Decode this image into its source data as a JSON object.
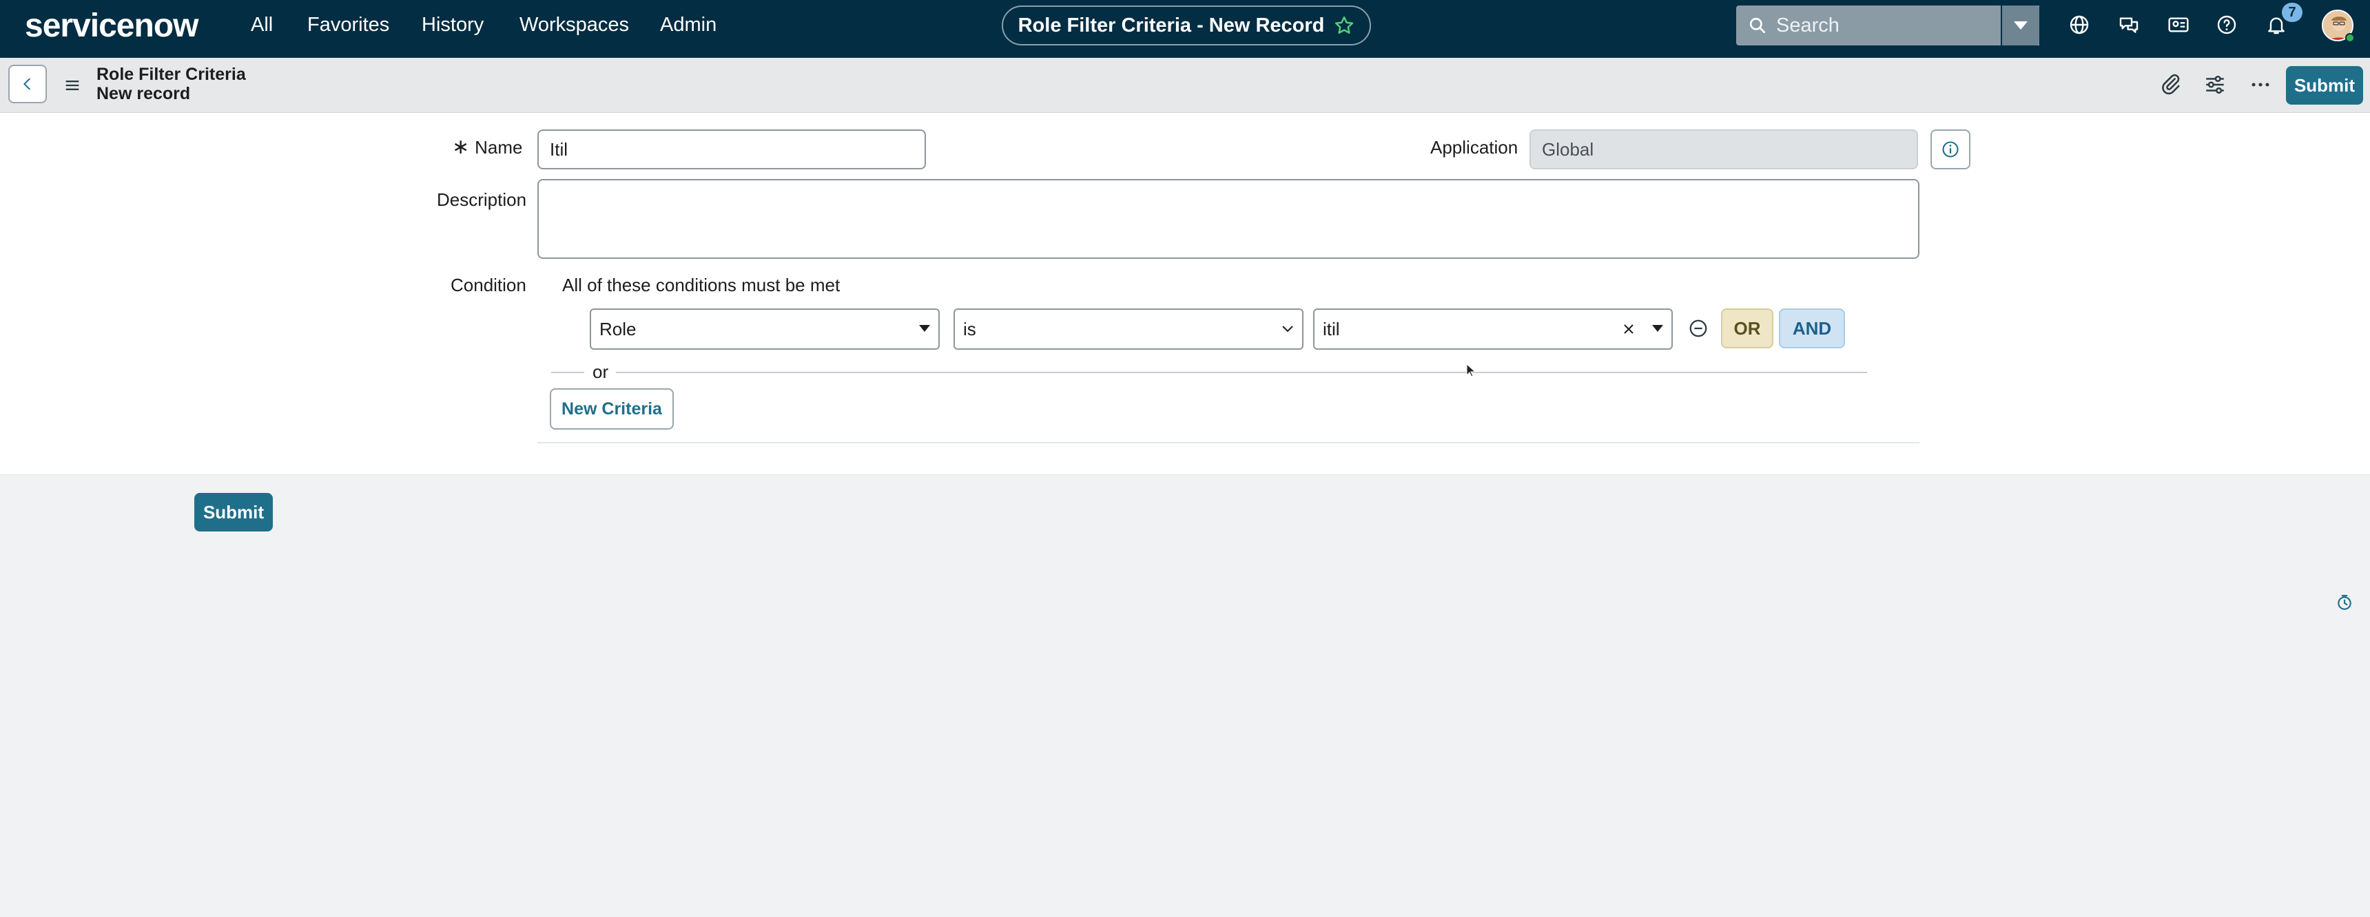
{
  "topnav": {
    "logo": "servicenow",
    "items": [
      "All",
      "Favorites",
      "History",
      "Workspaces",
      "Admin"
    ],
    "record_title": "Role Filter Criteria - New Record",
    "search_placeholder": "Search",
    "notification_count": "7"
  },
  "header": {
    "title": "Role Filter Criteria",
    "subtitle": "New record",
    "submit_label": "Submit"
  },
  "form": {
    "name_label": "Name",
    "name_value": "Itil",
    "application_label": "Application",
    "application_value": "Global",
    "description_label": "Description",
    "description_value": "",
    "condition_label": "Condition",
    "condition_text": "All of these conditions must be met",
    "condition": {
      "field": "Role",
      "operator": "is",
      "value": "itil"
    },
    "or_button": "OR",
    "and_button": "AND",
    "or_separator": "or",
    "new_criteria_label": "New Criteria"
  },
  "footer": {
    "submit_label": "Submit"
  },
  "colors": {
    "nav_bg": "#032d42",
    "primary": "#1f6f8b",
    "or_chip": "#efe6c6",
    "and_chip": "#cfe3f3"
  }
}
